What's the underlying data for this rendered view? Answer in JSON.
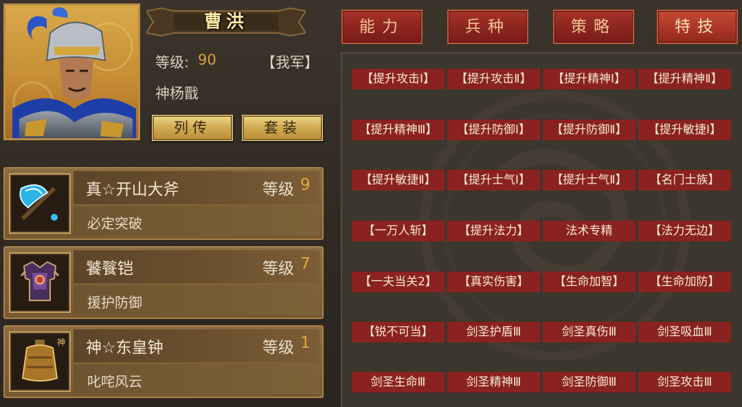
{
  "hero": {
    "name": "曹洪",
    "level_label": "等级:",
    "level_value": "90",
    "faction": "【我军】",
    "title": "神杨戬"
  },
  "buttons": {
    "biography": "列传",
    "set": "套装"
  },
  "equipment": [
    {
      "name": "真☆开山大斧",
      "level_label": "等级",
      "level": "9",
      "effect": "必定突破",
      "icon": "axe-icon"
    },
    {
      "name": "饕餮铠",
      "level_label": "等级",
      "level": "7",
      "effect": "援护防御",
      "icon": "armor-icon"
    },
    {
      "name": "神☆东皇钟",
      "level_label": "等级",
      "level": "1",
      "effect": "叱咤风云",
      "icon": "bell-icon"
    }
  ],
  "tabs": [
    "能力",
    "兵种",
    "策略",
    "特技"
  ],
  "active_tab": "特技",
  "skills": [
    "【提升攻击Ⅰ】",
    "【提升攻击Ⅱ】",
    "【提升精神Ⅰ】",
    "【提升精神Ⅱ】",
    "【提升精神Ⅲ】",
    "【提升防御Ⅰ】",
    "【提升防御Ⅱ】",
    "【提升敏捷Ⅰ】",
    "【提升敏捷Ⅱ】",
    "【提升士气Ⅰ】",
    "【提升士气Ⅱ】",
    "【名门士族】",
    "【一万人斩】",
    "【提升法力】",
    "法术专精",
    "【法力无边】",
    "【一夫当关2】",
    "【真实伤害】",
    "【生命加智】",
    "【生命加防】",
    "【锐不可当】",
    "剑圣护盾Ⅲ",
    "剑圣真伤Ⅲ",
    "剑圣吸血Ⅲ",
    "剑圣生命Ⅲ",
    "剑圣精神Ⅲ",
    "剑圣防御Ⅲ",
    "剑圣攻击Ⅲ"
  ],
  "colors": {
    "tab_red": "#8b2520",
    "skill_red": "#8a2220",
    "gold_level": "#d7a23c",
    "gold_button": "#d2ad55"
  }
}
